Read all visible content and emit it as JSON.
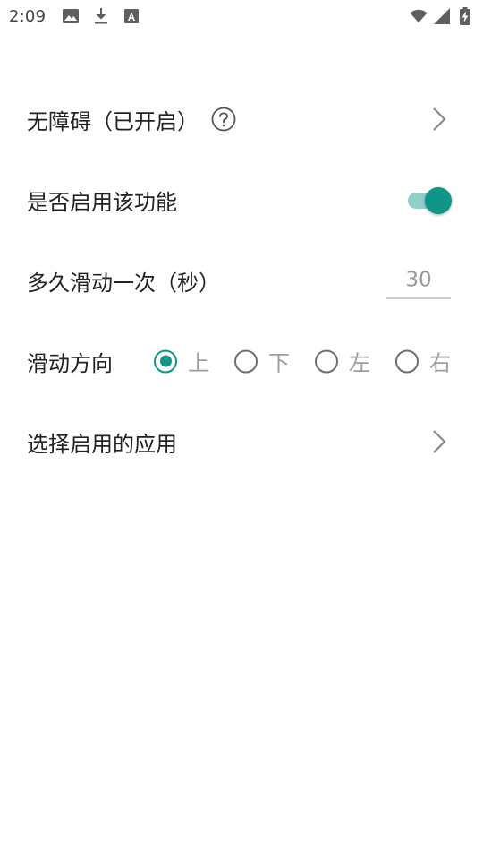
{
  "status_bar": {
    "time": "2:09",
    "icons_left": [
      "image-icon",
      "download-icon",
      "font-a-icon"
    ],
    "icons_right": [
      "wifi-icon",
      "signal-icon",
      "battery-charging-icon"
    ]
  },
  "settings": {
    "accessibility": {
      "label": "无障碍（已开启）",
      "help_icon": "help-circle-icon",
      "chevron_icon": "chevron-right-icon"
    },
    "enable": {
      "label": "是否启用该功能",
      "enabled": true
    },
    "interval": {
      "label": "多久滑动一次（秒）",
      "value": "",
      "placeholder": "30"
    },
    "direction": {
      "label": "滑动方向",
      "options": [
        "上",
        "下",
        "左",
        "右"
      ],
      "selected": "上"
    },
    "select_apps": {
      "label": "选择启用的应用",
      "chevron_icon": "chevron-right-icon"
    }
  },
  "colors": {
    "accent": "#109688",
    "accent_light": "#8fd0c7",
    "text_primary": "#222222",
    "text_secondary": "#9e9e9e"
  }
}
